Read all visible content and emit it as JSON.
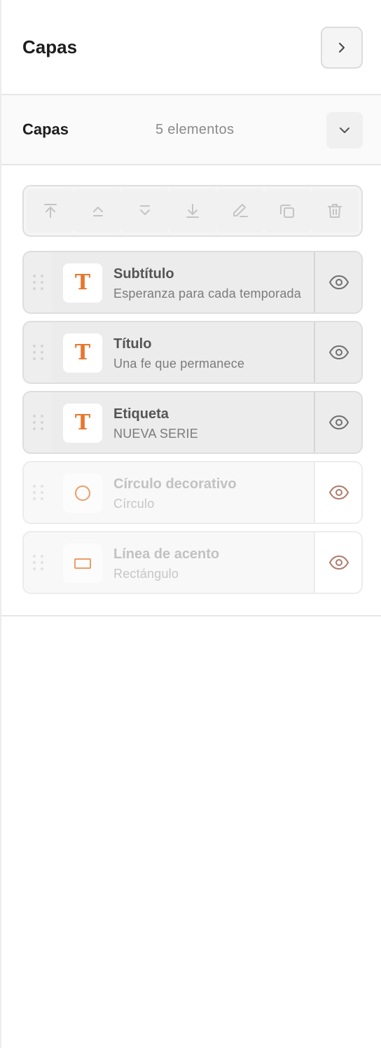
{
  "header": {
    "title": "Capas",
    "collapse_icon": "chevron-right-icon"
  },
  "section": {
    "title": "Capas",
    "count": "5 elementos",
    "toggle_icon": "chevron-down-icon"
  },
  "toolbar": {
    "buttons": [
      {
        "name": "bring-to-front",
        "icon": "arrow-to-top-icon"
      },
      {
        "name": "bring-forward",
        "icon": "chevron-up-icon"
      },
      {
        "name": "send-backward",
        "icon": "chevron-down-double-icon"
      },
      {
        "name": "send-to-back",
        "icon": "arrow-to-bottom-icon"
      },
      {
        "name": "rename",
        "icon": "pencil-icon"
      },
      {
        "name": "duplicate",
        "icon": "copy-icon"
      },
      {
        "name": "delete",
        "icon": "trash-icon"
      }
    ]
  },
  "layers": [
    {
      "name": "Subtítulo",
      "desc": "Esperanza para cada temporada",
      "thumb": "T",
      "kind": "text",
      "visible": true
    },
    {
      "name": "Título",
      "desc": "Una fe que permanece",
      "thumb": "T",
      "kind": "text",
      "visible": true
    },
    {
      "name": "Etiqueta",
      "desc": "NUEVA SERIE",
      "thumb": "T",
      "kind": "text",
      "visible": true
    },
    {
      "name": "Círculo decorativo",
      "desc": "Círculo",
      "thumb": "",
      "kind": "circle",
      "visible": false
    },
    {
      "name": "Línea de acento",
      "desc": "Rectángulo",
      "thumb": "",
      "kind": "rectangle",
      "visible": false
    }
  ],
  "colors": {
    "accent": "#e8772e",
    "eye_visible": "#6f6f6f",
    "eye_hidden": "#b07a6a",
    "toolbar_icon": "#c4c4c4"
  }
}
